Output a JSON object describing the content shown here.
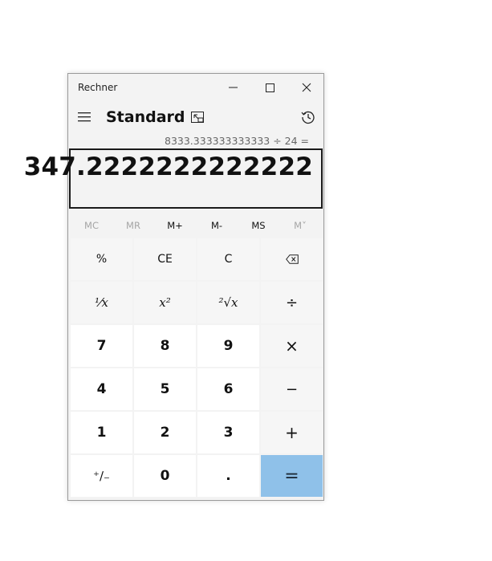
{
  "window": {
    "title": "Rechner"
  },
  "header": {
    "mode": "Standard"
  },
  "display": {
    "expression": "8333.333333333333 ÷ 24 =",
    "value": "347.2222222222222"
  },
  "memory": [
    {
      "label": "MC",
      "enabled": false
    },
    {
      "label": "MR",
      "enabled": false
    },
    {
      "label": "M+",
      "enabled": true
    },
    {
      "label": "M-",
      "enabled": true
    },
    {
      "label": "MS",
      "enabled": true
    },
    {
      "label": "M˅",
      "enabled": false
    }
  ],
  "keys": {
    "percent": "%",
    "ce": "CE",
    "c": "C",
    "reciprocal": "⅟x",
    "square": "x²",
    "sqrt": "²√x",
    "divide": "÷",
    "seven": "7",
    "eight": "8",
    "nine": "9",
    "multiply": "×",
    "four": "4",
    "five": "5",
    "six": "6",
    "minus": "−",
    "one": "1",
    "two": "2",
    "three": "3",
    "plus": "+",
    "negate": "⁺∕₋",
    "zero": "0",
    "decimal": ".",
    "equals": "="
  },
  "colors": {
    "accent": "#8fc1e9",
    "background": "#f3f3f3"
  }
}
